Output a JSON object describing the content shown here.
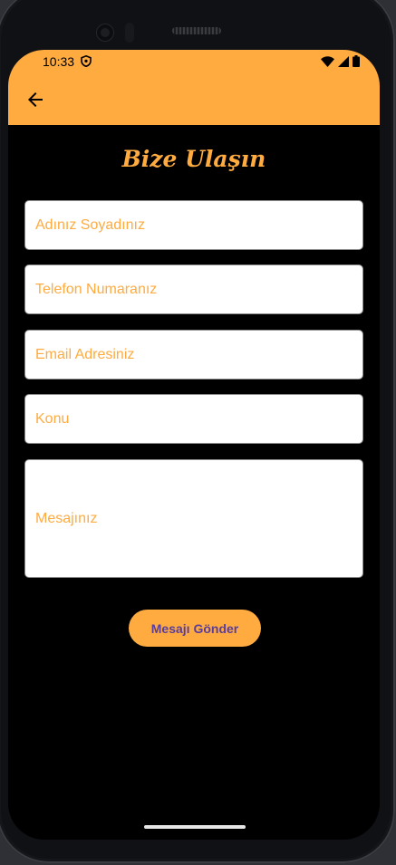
{
  "status_bar": {
    "time": "10:33",
    "icons": [
      "shield-icon",
      "wifi-icon",
      "cellular-icon",
      "battery-icon"
    ]
  },
  "app_bar": {
    "back_icon": "arrow-back-icon",
    "color": "#ffab40"
  },
  "page": {
    "title": "Bize Ulaşın"
  },
  "form": {
    "name_placeholder": "Adınız Soyadınız",
    "phone_placeholder": "Telefon Numaranız",
    "email_placeholder": "Email Adresiniz",
    "subject_placeholder": "Konu",
    "message_placeholder": "Mesajınız",
    "submit_label": "Mesajı Gönder"
  },
  "colors": {
    "accent": "#ffab40",
    "background": "#000000",
    "button_text": "#5a3e99"
  }
}
